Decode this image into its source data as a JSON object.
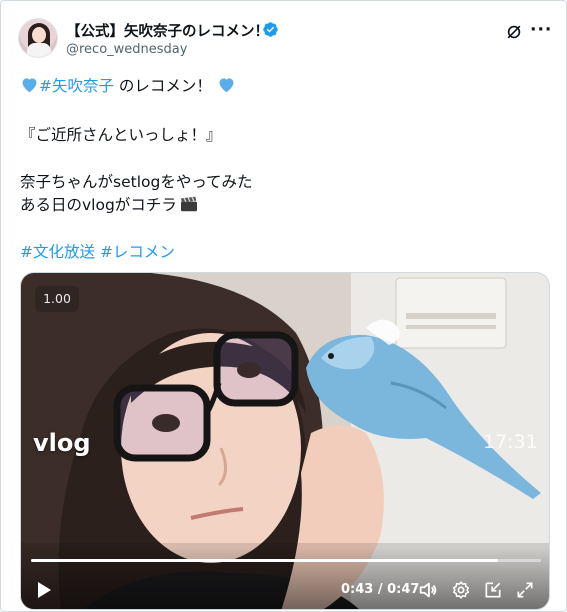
{
  "author": {
    "display_name": "【公式】矢吹奈子のレコメン！",
    "handle": "@reco_wednesday",
    "verified": true
  },
  "header_icons": {
    "grok": "grok-icon",
    "more": "more-icon",
    "more_glyph": "···"
  },
  "tweet": {
    "line1": {
      "tag": "#矢吹奈子",
      "text": " のレコメン！"
    },
    "line2": "『ご近所さんといっしょ！』",
    "line3": "奈子ちゃんがsetlogをやってみた",
    "line4": "ある日のvlogがコチラ",
    "hashtags": [
      "#文化放送",
      "#レコメン"
    ]
  },
  "video": {
    "speed": "1.00",
    "caption": "vlog",
    "overlay_time": "17:31",
    "time_display": "0:43 / 0:47",
    "progress": 0.915
  },
  "colors": {
    "accent": "#1d9bf0",
    "heart": "#5aaee8",
    "text": "#0f1419",
    "secondary": "#536471"
  }
}
